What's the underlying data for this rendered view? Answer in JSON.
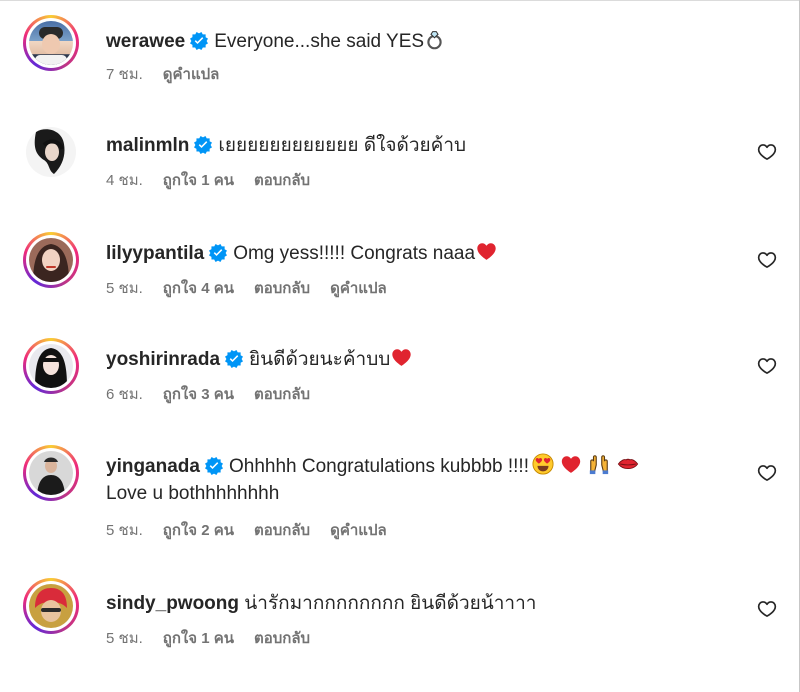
{
  "comments": [
    {
      "username": "werawee",
      "text": "Everyone...she said YES",
      "emoji": [
        "ring-emoji"
      ],
      "time": "7 ชม.",
      "see_translation": "ดูคำแปล"
    },
    {
      "username": "malinmln",
      "text": "เยยยยยยยยยยยย ดีใจด้วยค้าบ",
      "time": "4 ชม.",
      "likes": "ถูกใจ 1 คน",
      "reply": "ตอบกลับ"
    },
    {
      "username": "lilyypantila",
      "text": "Omg yess!!!!! Congrats naaa",
      "emoji": [
        "red-heart-emoji"
      ],
      "time": "5 ชม.",
      "likes": "ถูกใจ 4 คน",
      "reply": "ตอบกลับ",
      "see_translation": "ดูคำแปล"
    },
    {
      "username": "yoshirinrada",
      "text": "ยินดีด้วยนะค้าบบ",
      "emoji": [
        "red-heart-emoji"
      ],
      "time": "6 ชม.",
      "likes": "ถูกใจ 3 คน",
      "reply": "ตอบกลับ"
    },
    {
      "username": "yinganada",
      "text": "Ohhhhh Congratulations kubbbb !!!!",
      "text_line2": "Love u bothhhhhhhh",
      "emoji": [
        "heart-eyes-emoji",
        "red-heart-emoji",
        "raising-hands-emoji",
        "kiss-mark-emoji"
      ],
      "time": "5 ชม.",
      "likes": "ถูกใจ 2 คน",
      "reply": "ตอบกลับ",
      "see_translation": "ดูคำแปล"
    },
    {
      "username": "sindy_pwoong",
      "text": "น่ารักมากกกกกกกก ยินดีด้วยน้าาาา",
      "time": "5 ชม.",
      "likes": "ถูกใจ 1 คน",
      "reply": "ตอบกลับ"
    }
  ],
  "icons": {
    "verified": "verified-badge-icon",
    "like": "heart-outline-icon"
  },
  "colors": {
    "verified_blue": "#0095f6",
    "meta_gray": "#737373",
    "heart_red": "#e0242f"
  }
}
